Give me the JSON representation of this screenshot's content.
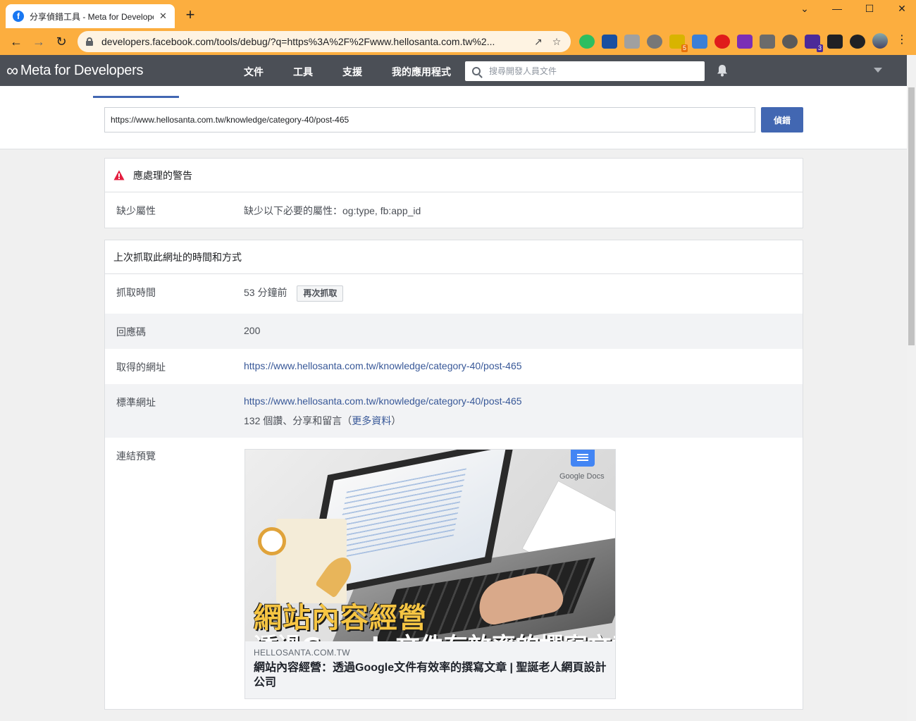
{
  "browser": {
    "tab_title": "分享偵錯工具 - Meta for Developers",
    "tab_favicon_letter": "f",
    "close_glyph": "✕",
    "new_tab_glyph": "+",
    "url": "developers.facebook.com/tools/debug/?q=https%3A%2F%2Fwww.hellosanta.com.tw%2...",
    "window_controls": [
      "⌄",
      "—",
      "☐",
      "✕"
    ],
    "extensions": [
      {
        "icon": "evernote-icon",
        "color": "#2dbe60",
        "badge": ""
      },
      {
        "icon": "vpn-icon",
        "color": "#1a4fa0",
        "badge": ""
      },
      {
        "icon": "check-icon",
        "color": "#a0a0a0",
        "badge": ""
      },
      {
        "icon": "translate-icon",
        "color": "#777777",
        "badge": ""
      },
      {
        "icon": "bulb-icon",
        "color": "#d8b400",
        "badge": "5"
      },
      {
        "icon": "screen-icon",
        "color": "#3b7fd6",
        "badge": ""
      },
      {
        "icon": "opera-icon",
        "color": "#e01b1b",
        "badge": ""
      },
      {
        "icon": "onenote-icon",
        "color": "#7b2fb5",
        "badge": ""
      },
      {
        "icon": "wordpress-icon",
        "color": "#6b6b6b",
        "badge": ""
      },
      {
        "icon": "window-icon",
        "color": "#5a5a5a",
        "badge": ""
      },
      {
        "icon": "diamond-icon",
        "color": "#4b2a99",
        "badge": "3"
      },
      {
        "icon": "puzzle-icon",
        "color": "#202124",
        "badge": ""
      },
      {
        "icon": "sidepanel-icon",
        "color": "#202124",
        "badge": ""
      }
    ]
  },
  "header": {
    "logo_text": "Meta for Developers",
    "logo_glyph": "∞",
    "nav": [
      "文件",
      "工具",
      "支援",
      "我的應用程式"
    ],
    "search_placeholder": "搜尋開發人員文件"
  },
  "debugger": {
    "input_value": "https://www.hellosanta.com.tw/knowledge/category-40/post-465",
    "button_label": "偵錯"
  },
  "warnings": {
    "title": "應處理的警告",
    "rows": [
      {
        "label": "缺少屬性",
        "value": "缺少以下必要的屬性：og:type, fb:app_id"
      }
    ]
  },
  "scrape": {
    "title": "上次抓取此網址的時間和方式",
    "fetch_time_label": "抓取時間",
    "fetch_time_value": "53 分鐘前",
    "refetch_button": "再次抓取",
    "response_code_label": "回應碼",
    "response_code_value": "200",
    "fetched_url_label": "取得的網址",
    "fetched_url_value": "https://www.hellosanta.com.tw/knowledge/category-40/post-465",
    "canonical_label": "標準網址",
    "canonical_value": "https://www.hellosanta.com.tw/knowledge/category-40/post-465",
    "engagement_prefix": "132 個讚、分享和留言（",
    "engagement_link": "更多資料",
    "engagement_suffix": "）",
    "preview_label": "連結預覽"
  },
  "preview": {
    "gdocs_label": "Google Docs",
    "headline_1": "網站內容經營",
    "headline_2": "透過Google文件有效率的撰寫文章",
    "domain": "HELLOSANTA.COM.TW",
    "title": "網站內容經營：透過Google文件有效率的撰寫文章 | 聖誕老人網頁設計公司"
  }
}
